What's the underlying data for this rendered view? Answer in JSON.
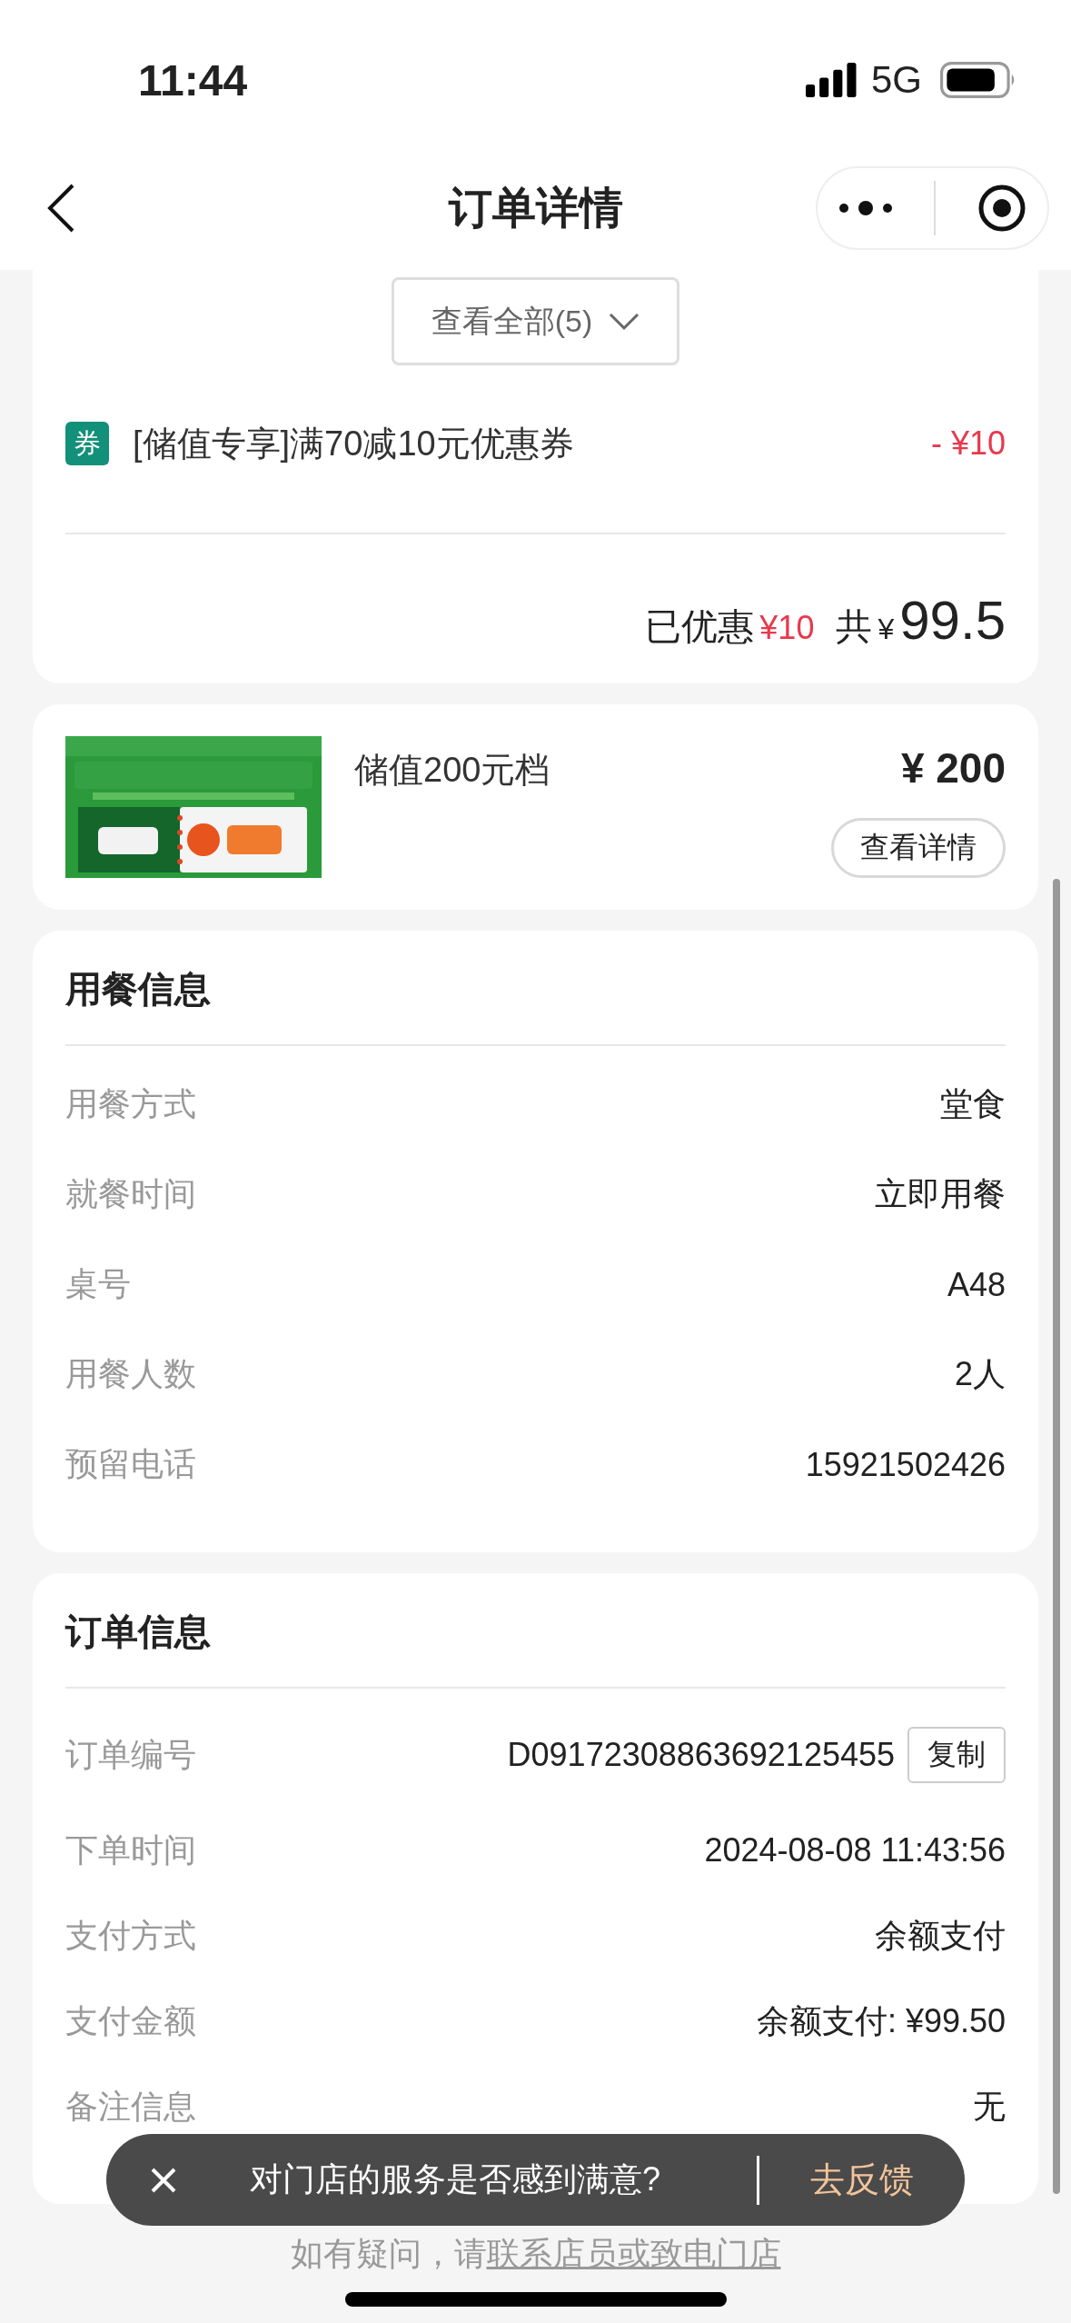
{
  "status_bar": {
    "time": "11:44",
    "network": "5G"
  },
  "nav": {
    "title": "订单详情"
  },
  "items_toggle": {
    "label": "查看全部(5)"
  },
  "discounts": [
    {
      "badge": "券",
      "name": "[储值专享]满70减10元优惠券",
      "amount": "- ¥10"
    }
  ],
  "summary": {
    "discount_label": "已优惠",
    "discount": "¥10",
    "total_label": "共",
    "currency": "¥",
    "total": "99.5"
  },
  "product": {
    "name": "储值200元档",
    "price": "¥ 200",
    "button": "查看详情"
  },
  "dining": {
    "title": "用餐信息",
    "rows": [
      {
        "label": "用餐方式",
        "value": "堂食"
      },
      {
        "label": "就餐时间",
        "value": "立即用餐"
      },
      {
        "label": "桌号",
        "value": "A48"
      },
      {
        "label": "用餐人数",
        "value": "2人"
      },
      {
        "label": "预留电话",
        "value": "15921502426"
      }
    ]
  },
  "order": {
    "title": "订单信息",
    "rows": [
      {
        "label": "订单编号",
        "value": "D09172308863692125455",
        "action": "复制"
      },
      {
        "label": "下单时间",
        "value": "2024-08-08 11:43:56"
      },
      {
        "label": "支付方式",
        "value": "余额支付"
      },
      {
        "label": "支付金额",
        "value": "余额支付: ¥99.50"
      },
      {
        "label": "备注信息",
        "value": "无"
      }
    ]
  },
  "toast": {
    "message": "对门店的服务是否感到满意?",
    "action": "去反馈"
  },
  "footer": {
    "text": "如有疑问，请",
    "link": "联系店员或致电门店"
  }
}
